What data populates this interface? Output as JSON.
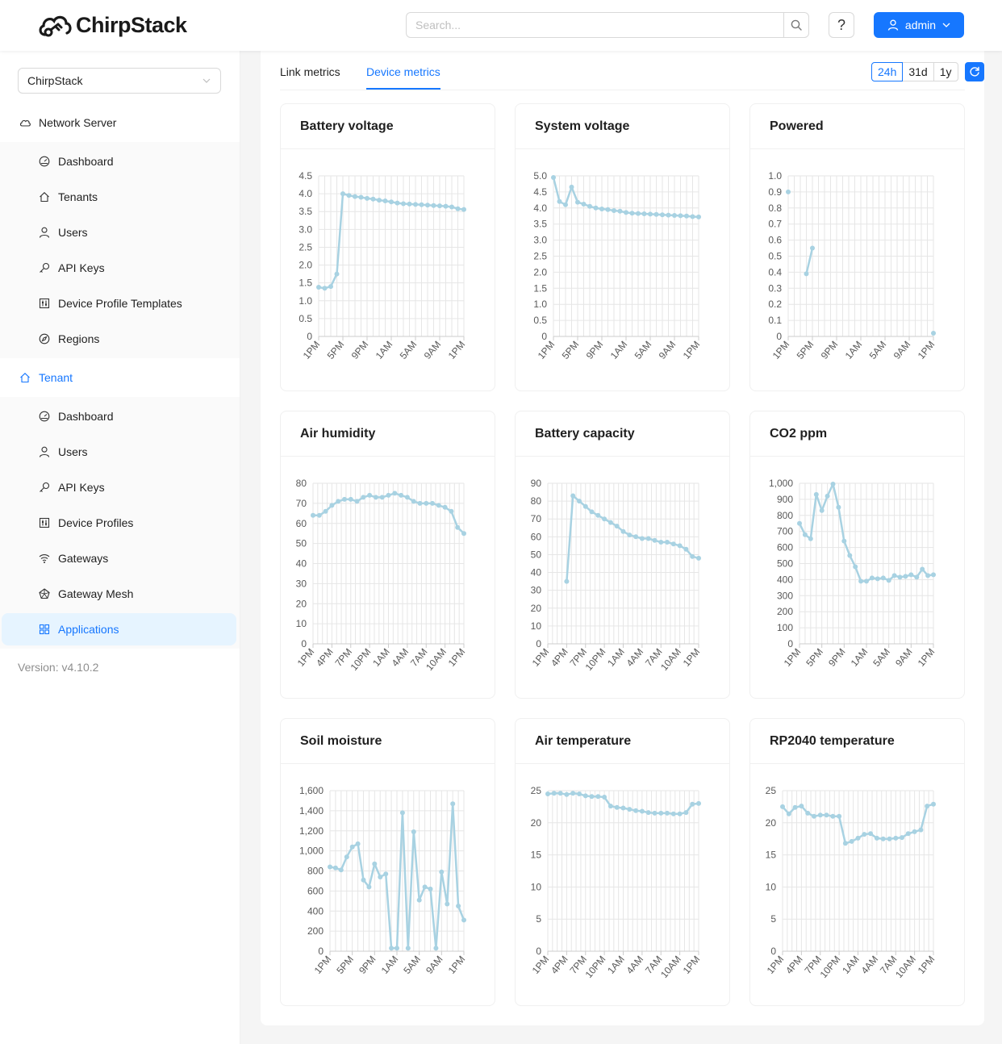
{
  "app": {
    "brand": "ChirpStack"
  },
  "header": {
    "search_placeholder": "Search...",
    "help_label": "?",
    "user_label": "admin"
  },
  "sidebar": {
    "tenant_select_value": "ChirpStack",
    "network_server": {
      "label": "Network Server",
      "items": [
        {
          "label": "Dashboard",
          "icon": "dashboard-icon"
        },
        {
          "label": "Tenants",
          "icon": "home-icon"
        },
        {
          "label": "Users",
          "icon": "user-icon"
        },
        {
          "label": "API Keys",
          "icon": "key-icon"
        },
        {
          "label": "Device Profile Templates",
          "icon": "sliders-icon"
        },
        {
          "label": "Regions",
          "icon": "compass-icon"
        }
      ]
    },
    "tenant": {
      "label": "Tenant",
      "items": [
        {
          "label": "Dashboard",
          "icon": "dashboard-icon"
        },
        {
          "label": "Users",
          "icon": "user-icon"
        },
        {
          "label": "API Keys",
          "icon": "key-icon"
        },
        {
          "label": "Device Profiles",
          "icon": "sliders-icon"
        },
        {
          "label": "Gateways",
          "icon": "wifi-icon"
        },
        {
          "label": "Gateway Mesh",
          "icon": "mesh-icon"
        },
        {
          "label": "Applications",
          "icon": "appstore-icon"
        }
      ]
    },
    "version": "Version: v4.10.2"
  },
  "tabs": [
    {
      "label": "Link metrics"
    },
    {
      "label": "Device metrics"
    }
  ],
  "active_tab": "Device metrics",
  "range_options": [
    "24h",
    "31d",
    "1y"
  ],
  "range_selected": "24h",
  "colors": {
    "accent": "#1677ff",
    "series": "#a8d2e2"
  },
  "chart_data": [
    {
      "type": "line",
      "title": "Battery voltage",
      "ylim": [
        0,
        4.5
      ],
      "yticks": [
        "0",
        "0.5",
        "1.0",
        "1.5",
        "2.0",
        "2.5",
        "3.0",
        "3.5",
        "4.0",
        "4.5"
      ],
      "xticks": [
        "1PM",
        "5PM",
        "9PM",
        "1AM",
        "5AM",
        "9AM",
        "1PM"
      ],
      "x": [
        0,
        1,
        2,
        3,
        4,
        5,
        6,
        7,
        8,
        9,
        10,
        11,
        12,
        13,
        14,
        15,
        16,
        17,
        18,
        19,
        20,
        21,
        22,
        23,
        24
      ],
      "values": [
        1.38,
        1.35,
        1.4,
        1.75,
        4.0,
        3.95,
        3.92,
        3.9,
        3.87,
        3.85,
        3.82,
        3.8,
        3.77,
        3.74,
        3.72,
        3.71,
        3.7,
        3.69,
        3.68,
        3.67,
        3.66,
        3.65,
        3.63,
        3.58,
        3.56
      ]
    },
    {
      "type": "line",
      "title": "System voltage",
      "ylim": [
        0,
        5.0
      ],
      "yticks": [
        "0",
        "0.5",
        "1.0",
        "1.5",
        "2.0",
        "2.5",
        "3.0",
        "3.5",
        "4.0",
        "4.5",
        "5.0"
      ],
      "xticks": [
        "1PM",
        "5PM",
        "9PM",
        "1AM",
        "5AM",
        "9AM",
        "1PM"
      ],
      "x": [
        0,
        1,
        2,
        3,
        4,
        5,
        6,
        7,
        8,
        9,
        10,
        11,
        12,
        13,
        14,
        15,
        16,
        17,
        18,
        19,
        20,
        21,
        22,
        23,
        24
      ],
      "values": [
        4.95,
        4.2,
        4.1,
        4.65,
        4.18,
        4.12,
        4.05,
        4.0,
        3.97,
        3.95,
        3.92,
        3.9,
        3.86,
        3.84,
        3.83,
        3.82,
        3.81,
        3.8,
        3.79,
        3.78,
        3.77,
        3.76,
        3.75,
        3.73,
        3.72
      ]
    },
    {
      "type": "line",
      "title": "Powered",
      "ylim": [
        0,
        1.0
      ],
      "yticks": [
        "0",
        "0.1",
        "0.2",
        "0.3",
        "0.4",
        "0.5",
        "0.6",
        "0.7",
        "0.8",
        "0.9",
        "1.0"
      ],
      "xticks": [
        "1PM",
        "5PM",
        "9PM",
        "1AM",
        "5AM",
        "9AM",
        "1PM"
      ],
      "x": [
        0,
        3,
        4,
        24
      ],
      "values": [
        0.9,
        0.39,
        0.55,
        0.02
      ],
      "segments": [
        [
          0
        ],
        [
          1,
          2
        ],
        [
          3
        ]
      ]
    },
    {
      "type": "line",
      "title": "Air humidity",
      "ylim": [
        0,
        80
      ],
      "yticks": [
        "0",
        "10",
        "20",
        "30",
        "40",
        "50",
        "60",
        "70",
        "80"
      ],
      "xticks": [
        "1PM",
        "4PM",
        "7PM",
        "10PM",
        "1AM",
        "4AM",
        "7AM",
        "10AM",
        "1PM"
      ],
      "x": [
        0,
        1,
        2,
        3,
        4,
        5,
        6,
        7,
        8,
        9,
        10,
        11,
        12,
        13,
        14,
        15,
        16,
        17,
        18,
        19,
        20,
        21,
        22,
        23,
        24
      ],
      "values": [
        64,
        64,
        66,
        69,
        71,
        72,
        72,
        71,
        73,
        74,
        73,
        73,
        74,
        75,
        74,
        73,
        71,
        70,
        70,
        70,
        69,
        68,
        66,
        58,
        55
      ]
    },
    {
      "type": "line",
      "title": "Battery capacity",
      "ylim": [
        0,
        90
      ],
      "yticks": [
        "0",
        "10",
        "20",
        "30",
        "40",
        "50",
        "60",
        "70",
        "80",
        "90"
      ],
      "xticks": [
        "1PM",
        "4PM",
        "7PM",
        "10PM",
        "1AM",
        "4AM",
        "7AM",
        "10AM",
        "1PM"
      ],
      "x": [
        3,
        4,
        5,
        6,
        7,
        8,
        9,
        10,
        11,
        12,
        13,
        14,
        15,
        16,
        17,
        18,
        19,
        20,
        21,
        22,
        23,
        24
      ],
      "values": [
        35,
        83,
        80,
        77,
        74,
        72,
        70,
        68,
        66,
        63,
        61,
        60,
        59,
        59,
        58,
        57,
        57,
        56,
        55,
        53,
        49,
        48
      ]
    },
    {
      "type": "line",
      "title": "CO2 ppm",
      "ylim": [
        0,
        1000
      ],
      "yticks": [
        "0",
        "100",
        "200",
        "300",
        "400",
        "500",
        "600",
        "700",
        "800",
        "900",
        "1,000"
      ],
      "xticks": [
        "1PM",
        "5PM",
        "9PM",
        "1AM",
        "5AM",
        "9AM",
        "1PM"
      ],
      "x": [
        0,
        1,
        2,
        3,
        4,
        5,
        6,
        7,
        8,
        9,
        10,
        11,
        12,
        13,
        14,
        15,
        16,
        17,
        18,
        19,
        20,
        21,
        22,
        23,
        24
      ],
      "values": [
        750,
        680,
        655,
        930,
        830,
        920,
        995,
        850,
        640,
        550,
        480,
        390,
        390,
        410,
        405,
        410,
        395,
        425,
        415,
        420,
        430,
        415,
        465,
        425,
        430
      ]
    },
    {
      "type": "line",
      "title": "Soil moisture",
      "ylim": [
        0,
        1600
      ],
      "yticks": [
        "0",
        "200",
        "400",
        "600",
        "800",
        "1,000",
        "1,200",
        "1,400",
        "1,600"
      ],
      "xticks": [
        "1PM",
        "5PM",
        "9PM",
        "1AM",
        "5AM",
        "9AM",
        "1PM"
      ],
      "x": [
        0,
        1,
        2,
        3,
        4,
        5,
        6,
        7,
        8,
        9,
        10,
        11,
        12,
        13,
        14,
        15,
        16,
        17,
        18,
        19,
        20,
        21,
        22,
        23,
        24
      ],
      "values": [
        840,
        830,
        810,
        940,
        1040,
        1070,
        710,
        640,
        870,
        740,
        770,
        30,
        30,
        1380,
        30,
        1190,
        510,
        640,
        620,
        30,
        790,
        470,
        1470,
        450,
        310
      ]
    },
    {
      "type": "line",
      "title": "Air temperature",
      "ylim": [
        0,
        25
      ],
      "yticks": [
        "0",
        "5",
        "10",
        "15",
        "20",
        "25"
      ],
      "xticks": [
        "1PM",
        "4PM",
        "7PM",
        "10PM",
        "1AM",
        "4AM",
        "7AM",
        "10AM",
        "1PM"
      ],
      "x": [
        0,
        1,
        2,
        3,
        4,
        5,
        6,
        7,
        8,
        9,
        10,
        11,
        12,
        13,
        14,
        15,
        16,
        17,
        18,
        19,
        20,
        21,
        22,
        23,
        24
      ],
      "values": [
        24.5,
        24.6,
        24.6,
        24.4,
        24.6,
        24.5,
        24.2,
        24.1,
        24.1,
        24.0,
        22.6,
        22.4,
        22.3,
        22.1,
        21.9,
        21.8,
        21.6,
        21.5,
        21.5,
        21.5,
        21.4,
        21.4,
        21.6,
        22.9,
        23.0
      ]
    },
    {
      "type": "line",
      "title": "RP2040 temperature",
      "ylim": [
        0,
        25
      ],
      "yticks": [
        "0",
        "5",
        "10",
        "15",
        "20",
        "25"
      ],
      "xticks": [
        "1PM",
        "4PM",
        "7PM",
        "10PM",
        "1AM",
        "4AM",
        "7AM",
        "10AM",
        "1PM"
      ],
      "x": [
        0,
        1,
        2,
        3,
        4,
        5,
        6,
        7,
        8,
        9,
        10,
        11,
        12,
        13,
        14,
        15,
        16,
        17,
        18,
        19,
        20,
        21,
        22,
        23,
        24
      ],
      "values": [
        22.5,
        21.4,
        22.4,
        22.6,
        21.5,
        21.0,
        21.2,
        21.2,
        21.0,
        21.0,
        16.8,
        17.1,
        17.6,
        18.2,
        18.3,
        17.6,
        17.5,
        17.5,
        17.6,
        17.7,
        18.3,
        18.6,
        18.9,
        22.6,
        22.9
      ]
    }
  ]
}
